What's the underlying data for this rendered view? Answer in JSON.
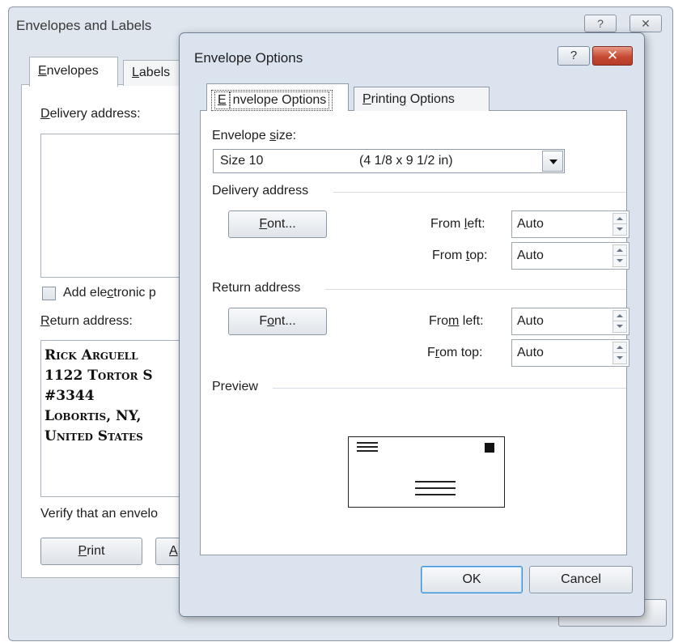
{
  "background_window": {
    "title": "Envelopes and Labels",
    "help_label": "?",
    "close_label": "✕",
    "tabs": [
      {
        "label": "Envelopes",
        "underline": "E",
        "rest": "nvelopes"
      },
      {
        "label": "Labels",
        "underline": "L",
        "rest": "abels"
      }
    ],
    "delivery_address_label": {
      "underline": "D",
      "rest": "elivery address:"
    },
    "epostage_label": {
      "pre": "Add ele",
      "underline": "c",
      "post": "tronic p"
    },
    "return_address_label": {
      "underline": "R",
      "rest": "eturn address:"
    },
    "return_address_lines": [
      "Rick Arguell",
      "1122 Tortor S",
      "#3344",
      "Lobortis, NY,",
      "United States"
    ],
    "verify_text": "Verify that an envelo",
    "print_button": {
      "underline": "P",
      "rest": "rint"
    },
    "add_button": {
      "underline": "A",
      "rest": ""
    }
  },
  "dialog": {
    "title": "Envelope Options",
    "help_label": "?",
    "close_label": "✕",
    "tabs": [
      {
        "label": "Envelope Options",
        "underline": "E",
        "rest": "nvelope Options",
        "active": true
      },
      {
        "label": "Printing Options",
        "underline": "P",
        "rest": "rinting Options",
        "active": false
      }
    ],
    "envelope_size": {
      "label_pre": "Envelope ",
      "label_underline": "s",
      "label_post": "ize:",
      "selected_name": "Size 10",
      "selected_dims": "(4 1/8 x 9 1/2 in)"
    },
    "delivery_address": {
      "group_label": "Delivery address",
      "font_button": {
        "underline": "F",
        "rest": "ont..."
      },
      "from_left_label": {
        "pre": "From ",
        "underline": "l",
        "post": "eft:"
      },
      "from_left_value": "Auto",
      "from_top_label": {
        "pre": "From ",
        "underline": "t",
        "post": "op:"
      },
      "from_top_value": "Auto"
    },
    "return_address": {
      "group_label": "Return address",
      "font_button": {
        "pre": "F",
        "underline": "o",
        "post": "nt..."
      },
      "from_left_label": {
        "pre": "Fro",
        "underline": "m",
        "post": " left:"
      },
      "from_left_value": "Auto",
      "from_top_label": {
        "pre": "F",
        "underline": "r",
        "post": "om top:"
      },
      "from_top_value": "Auto"
    },
    "preview_label": "Preview",
    "ok_label": "OK",
    "cancel_label": "Cancel"
  }
}
